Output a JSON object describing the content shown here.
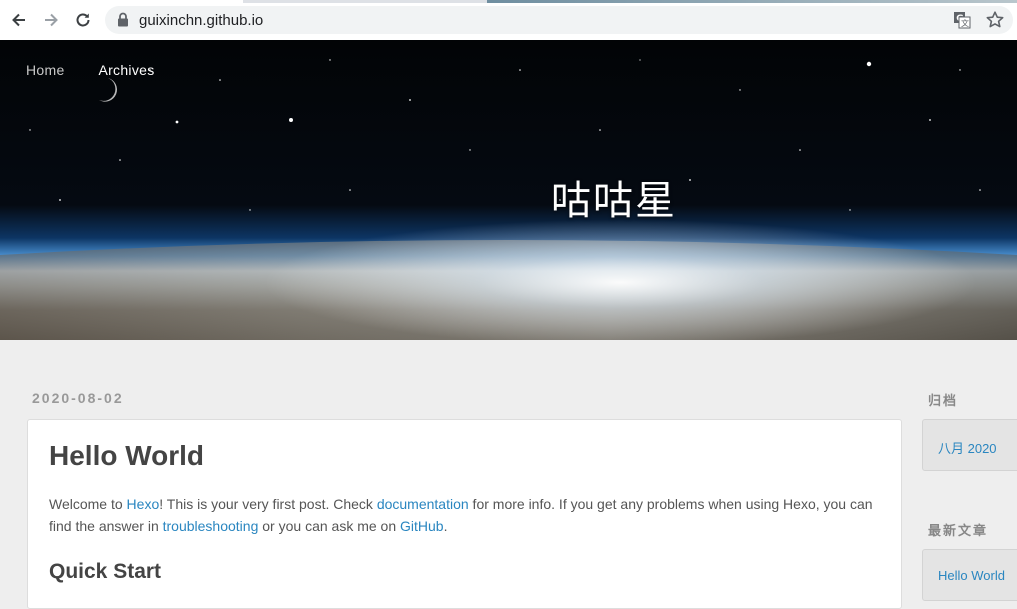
{
  "browser": {
    "url": "guixinchn.github.io",
    "icons": [
      "back-icon",
      "forward-icon",
      "reload-icon",
      "lock-icon",
      "translate-icon",
      "star-icon"
    ]
  },
  "nav": {
    "home": "Home",
    "archives": "Archives"
  },
  "hero": {
    "title": "咕咕星"
  },
  "post": {
    "date": "2020-08-02",
    "title": "Hello World",
    "intro_1": "Welcome to ",
    "hexo_link": "Hexo",
    "intro_2": "! This is your very first post. Check ",
    "docs_link": "documentation",
    "intro_3": " for more info. If you get any problems when using Hexo, you can find the answer in ",
    "troubleshooting_link": "troubleshooting",
    "intro_4": " or you can ask me on ",
    "github_link": "GitHub",
    "intro_5": ".",
    "quick_start": "Quick Start"
  },
  "sidebar": {
    "archive_heading": "归档",
    "archive_item": "八月 2020",
    "recent_heading": "最新文章",
    "recent_item": "Hello World"
  },
  "colors": {
    "link": "#2a86c0",
    "page_bg": "#eeeeee"
  }
}
